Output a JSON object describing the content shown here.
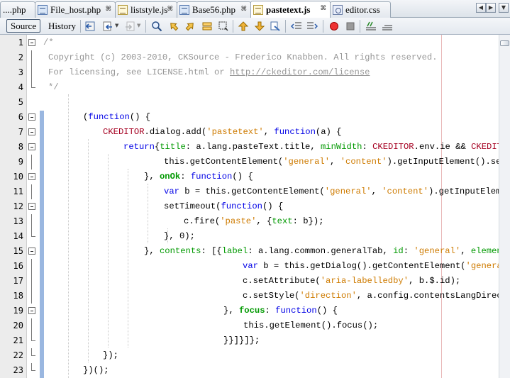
{
  "tabs": [
    {
      "label": "....php",
      "icon": "php-file-icon",
      "active": false
    },
    {
      "label": "File_host.php",
      "icon": "php-file-icon",
      "active": false
    },
    {
      "label": "liststyle.js",
      "icon": "js-file-icon",
      "active": false
    },
    {
      "label": "Base56.php",
      "icon": "php-file-icon",
      "active": false
    },
    {
      "label": "pastetext.js",
      "icon": "js-file-icon",
      "active": true
    },
    {
      "label": "editor.css",
      "icon": "css-file-icon",
      "active": false
    }
  ],
  "tab_close_glyph": "⌘",
  "nav": {
    "prev": "◀",
    "next": "▶",
    "menu": "▼"
  },
  "toolbar": {
    "source_label": "Source",
    "history_label": "History"
  },
  "editor": {
    "line_numbers": [
      "1",
      "2",
      "3",
      "4",
      "5",
      "6",
      "7",
      "8",
      "9",
      "10",
      "11",
      "12",
      "13",
      "14",
      "15",
      "16",
      "17",
      "18",
      "19",
      "20",
      "21",
      "22",
      "23"
    ],
    "lines": [
      "/*",
      "Copyright (c) 2003-2010, CKSource - Frederico Knabben. All rights reserved.",
      "For licensing, see LICENSE.html or http://ckeditor.com/license",
      "*/",
      "",
      "(function() {",
      "CKEDITOR.dialog.add('pastetext', function(a) {",
      "return{title: a.lang.pasteText.title, minWidth: CKEDITOR.env.ie && CKEDITOR.e",
      "this.getContentElement('general', 'content').getInputElement().setVal",
      "}, onOk: function() {",
      "var b = this.getContentElement('general', 'content').getInputElement(",
      "setTimeout(function() {",
      "c.fire('paste', {text: b});",
      "}, 0);",
      "}, contents: [{label: a.lang.common.generalTab, id: 'general', elements:",
      "var b = this.getDialog().getContentElement('general',",
      "c.setAttribute('aria-labelledby', b.$.id);",
      "c.setStyle('direction', a.config.contentsLangDirectio",
      "}, focus: function() {",
      "this.getElement().focus();",
      "}}]}]};",
      "});",
      "})();"
    ]
  },
  "colors": {
    "keyword": "#0000e6",
    "string": "#ce7b00",
    "comment": "#969696",
    "object": "#a50021",
    "property": "#009900",
    "change_bar": "#9ab7e0",
    "right_margin": "#e8b8b8"
  }
}
